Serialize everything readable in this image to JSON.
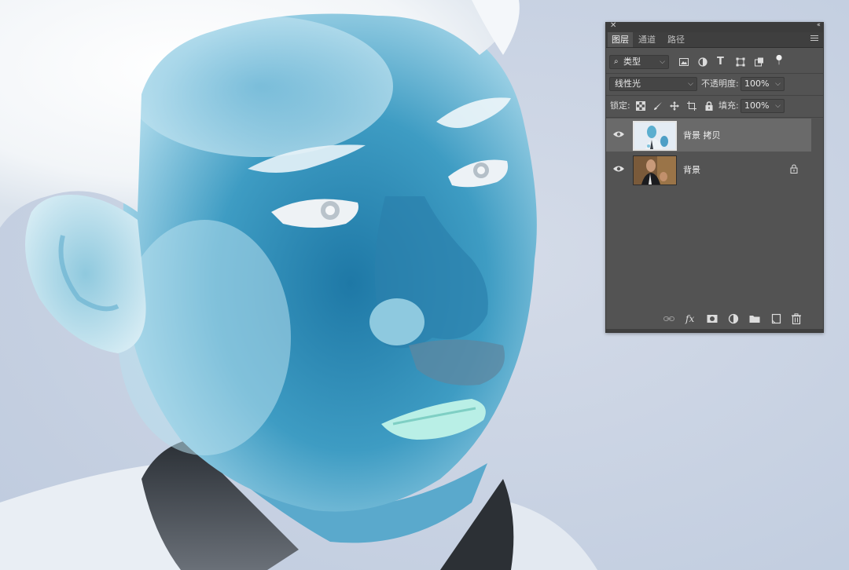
{
  "panel": {
    "tabs": [
      {
        "label": "图层",
        "active": true
      },
      {
        "label": "通道",
        "active": false
      },
      {
        "label": "路径",
        "active": false
      }
    ],
    "filter": {
      "kind_label": "类型",
      "icons": [
        "image-filter-icon",
        "adjustment-filter-icon",
        "type-filter-icon",
        "shape-filter-icon",
        "smart-object-filter-icon",
        "filter-toggle-icon"
      ]
    },
    "blend": {
      "mode": "线性光",
      "opacity_label": "不透明度:",
      "opacity": "100%"
    },
    "lock": {
      "label": "锁定:",
      "fill_label": "填充:",
      "fill": "100%",
      "icons": [
        "lock-transparent-icon",
        "lock-image-icon",
        "lock-position-icon",
        "lock-artboard-icon",
        "lock-all-icon"
      ]
    },
    "layers": [
      {
        "name": "背景 拷贝",
        "selected": true,
        "visible": true,
        "locked": false
      },
      {
        "name": "背景",
        "selected": false,
        "visible": true,
        "locked": true
      }
    ],
    "footer_icons": [
      "link-layers-icon",
      "fx-icon",
      "add-mask-icon",
      "adjustment-layer-icon",
      "new-group-icon",
      "new-layer-icon",
      "trash-icon"
    ]
  },
  "colors": {
    "panel_bg": "#535353",
    "selected_row": "#6a6a6a",
    "canvas_bg": "#c9d3e3",
    "face_cyan": "#2e8cb3"
  }
}
